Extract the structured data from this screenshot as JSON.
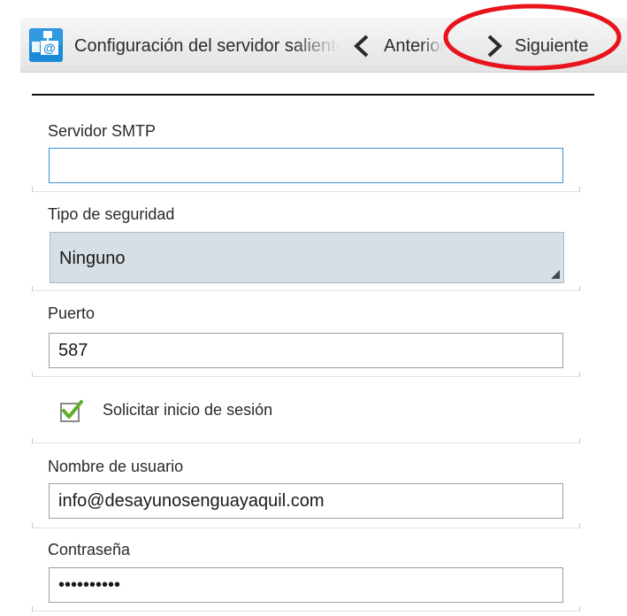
{
  "header": {
    "title": "Configuración del servidor saliente",
    "prev_label": "Anterior",
    "next_label": "Siguiente",
    "app_icon": "email-server-icon",
    "prev_icon": "chevron-left-icon",
    "next_icon": "chevron-right-icon",
    "highlight_color": "#e8131b"
  },
  "form": {
    "smtp": {
      "label": "Servidor SMTP",
      "value": ""
    },
    "security": {
      "label": "Tipo de seguridad",
      "value": "Ninguno"
    },
    "port": {
      "label": "Puerto",
      "value": "587"
    },
    "require_login": {
      "label": "Solicitar inicio de sesión",
      "checked": true,
      "check_color": "#5fae2b"
    },
    "username": {
      "label": "Nombre de usuario",
      "value": "info@desayunosenguayaquil.com"
    },
    "password": {
      "label": "Contraseña",
      "value": "••••••••••"
    }
  },
  "colors": {
    "focus_border": "#3a93d6",
    "spinner_bg": "#d6dfe5",
    "icon_blue": "#1a8ad8"
  }
}
